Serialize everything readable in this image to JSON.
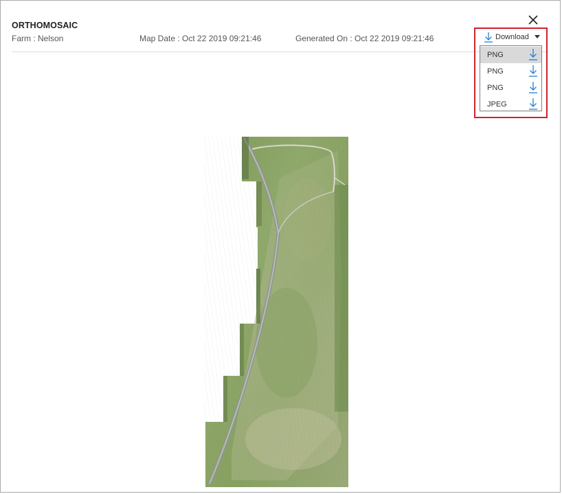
{
  "header": {
    "title": "ORTHOMOSAIC",
    "farm": "Farm :  Nelson",
    "map_date": "Map Date : Oct 22 2019 09:21:46",
    "generated_on": "Generated On : Oct 22 2019 09:21:46"
  },
  "download": {
    "label": "Download",
    "options": [
      {
        "label": "PNG",
        "selected": true
      },
      {
        "label": "PNG",
        "selected": false
      },
      {
        "label": "PNG",
        "selected": false
      },
      {
        "label": "JPEG",
        "selected": false
      }
    ]
  },
  "icons": {
    "close": "close-icon",
    "download": "download-arrow-icon",
    "dropdown": "caret-down-icon"
  },
  "colors": {
    "accent_blue": "#1e7fd9",
    "highlight_red": "#d2202a",
    "selected_row": "#d9d9d9"
  }
}
